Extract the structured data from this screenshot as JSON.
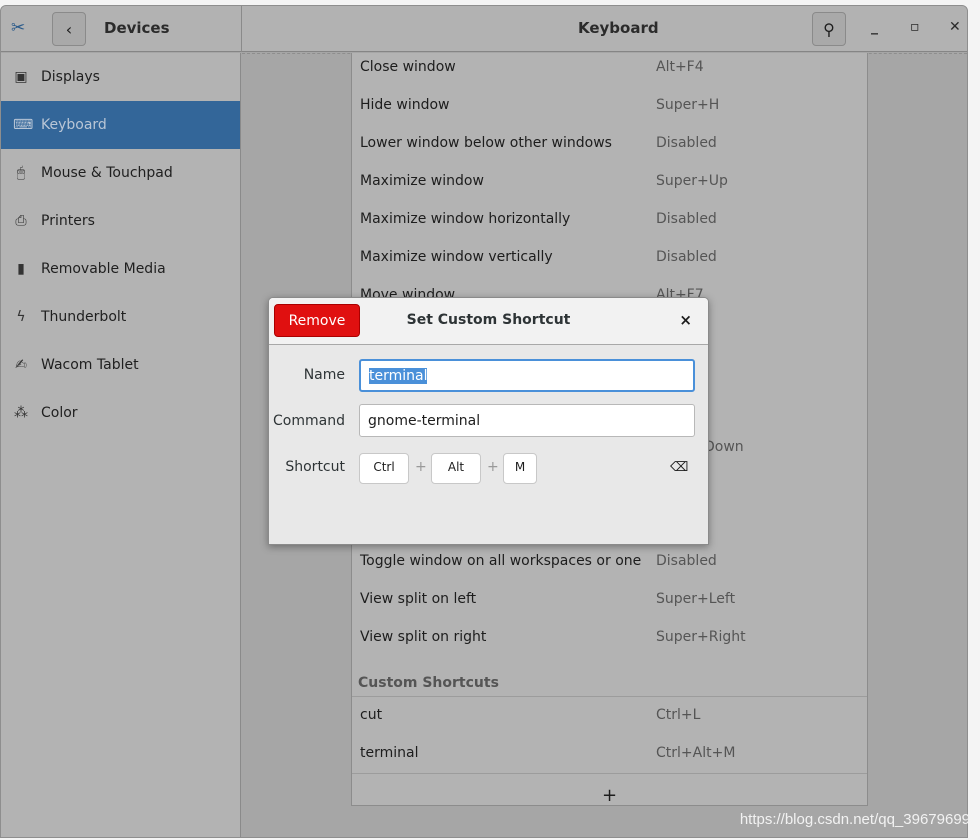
{
  "header": {
    "section_title": "Devices",
    "page_title": "Keyboard"
  },
  "sidebar": {
    "items": [
      {
        "label": "Displays",
        "icon": "display-icon",
        "glyph": "▣"
      },
      {
        "label": "Keyboard",
        "icon": "keyboard-icon",
        "glyph": "⌨",
        "selected": true
      },
      {
        "label": "Mouse & Touchpad",
        "icon": "mouse-icon",
        "glyph": "🖱"
      },
      {
        "label": "Printers",
        "icon": "printer-icon",
        "glyph": "⎙"
      },
      {
        "label": "Removable Media",
        "icon": "usb-icon",
        "glyph": "▮"
      },
      {
        "label": "Thunderbolt",
        "icon": "thunderbolt-icon",
        "glyph": "ϟ"
      },
      {
        "label": "Wacom Tablet",
        "icon": "tablet-icon",
        "glyph": "✍"
      },
      {
        "label": "Color",
        "icon": "color-icon",
        "glyph": "⁂"
      }
    ]
  },
  "shortcuts": [
    {
      "name": "Close window",
      "keys": "Alt+F4"
    },
    {
      "name": "Hide window",
      "keys": "Super+H"
    },
    {
      "name": "Lower window below other windows",
      "keys": "Disabled"
    },
    {
      "name": "Maximize window",
      "keys": "Super+Up"
    },
    {
      "name": "Maximize window horizontally",
      "keys": "Disabled"
    },
    {
      "name": "Maximize window vertically",
      "keys": "Disabled"
    },
    {
      "name": "Move window",
      "keys": "Alt+F7"
    },
    {
      "name": "",
      "keys": "Down"
    },
    {
      "name": "Toggle window on all workspaces or one",
      "keys": "Disabled"
    },
    {
      "name": "View split on left",
      "keys": "Super+Left"
    },
    {
      "name": "View split on right",
      "keys": "Super+Right"
    }
  ],
  "custom": {
    "title": "Custom Shortcuts",
    "items": [
      {
        "name": "cut",
        "keys": "Ctrl+L"
      },
      {
        "name": "terminal",
        "keys": "Ctrl+Alt+M"
      }
    ],
    "add": "+"
  },
  "dialog": {
    "title": "Set Custom Shortcut",
    "remove": "Remove",
    "close": "×",
    "name_label": "Name",
    "name_value": "terminal",
    "command_label": "Command",
    "command_value": "gnome-terminal",
    "shortcut_label": "Shortcut",
    "keys": [
      "Ctrl",
      "Alt",
      "M"
    ],
    "plus": "+",
    "clear": "⌫"
  },
  "watermark": "https://blog.csdn.net/qq_39679699",
  "colors": {
    "accent": "#336699",
    "destructive": "#e01010",
    "focus": "#4a90d9"
  }
}
